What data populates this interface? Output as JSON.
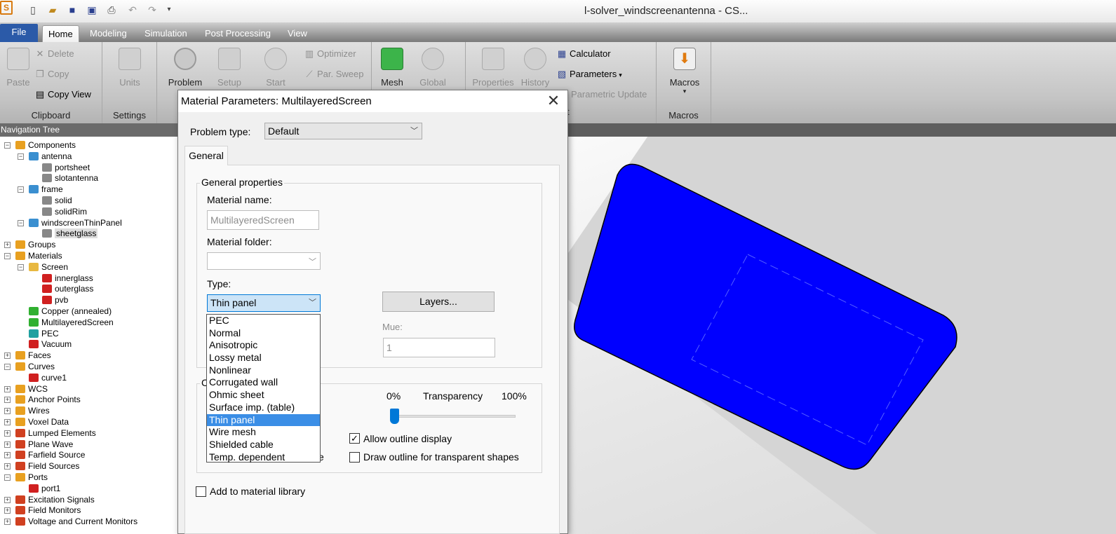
{
  "window": {
    "title": "l-solver_windscreenantenna - CS..."
  },
  "quick_access": [
    "new-file-icon",
    "open-folder-icon",
    "save-icon",
    "save-all-icon",
    "print-icon",
    "undo-icon",
    "redo-icon",
    "customize-dropdown-icon"
  ],
  "ribbon_tabs": [
    "File",
    "Home",
    "Modeling",
    "Simulation",
    "Post Processing",
    "View"
  ],
  "ribbon_active_tab": "Home",
  "ribbon": {
    "clipboard": {
      "paste": "Paste",
      "delete": "Delete",
      "copy": "Copy",
      "copy_view": "Copy View",
      "label": "Clipboard"
    },
    "settings": {
      "units": "Units",
      "label": "Settings"
    },
    "problem": "Problem",
    "problem_fragment": "T",
    "setup": "Setup",
    "start": "Start",
    "optimizer": "Optimizer",
    "par_sweep": "Par. Sweep",
    "mesh": "Mesh",
    "global": "Global",
    "properties": "Properties",
    "history": "History",
    "calculator": "Calculator",
    "parameters": "Parameters",
    "parametric_update": "Parametric Update",
    "macros": {
      "button": "Macros",
      "label": "Macros"
    },
    "mesh_group_fragment": "t"
  },
  "nav": {
    "header": "Navigation Tree",
    "items": [
      {
        "label": "Components"
      },
      {
        "label": "antenna"
      },
      {
        "label": "portsheet"
      },
      {
        "label": "slotantenna"
      },
      {
        "label": "frame"
      },
      {
        "label": "solid"
      },
      {
        "label": "solidRim"
      },
      {
        "label": "windscreenThinPanel"
      },
      {
        "label": "sheetglass"
      },
      {
        "label": "Groups"
      },
      {
        "label": "Materials"
      },
      {
        "label": "Screen"
      },
      {
        "label": "innerglass"
      },
      {
        "label": "outerglass"
      },
      {
        "label": "pvb"
      },
      {
        "label": "Copper (annealed)"
      },
      {
        "label": "MultilayeredScreen"
      },
      {
        "label": "PEC"
      },
      {
        "label": "Vacuum"
      },
      {
        "label": "Faces"
      },
      {
        "label": "Curves"
      },
      {
        "label": "curve1"
      },
      {
        "label": "WCS"
      },
      {
        "label": "Anchor Points"
      },
      {
        "label": "Wires"
      },
      {
        "label": "Voxel Data"
      },
      {
        "label": "Lumped Elements"
      },
      {
        "label": "Plane Wave"
      },
      {
        "label": "Farfield Source"
      },
      {
        "label": "Field Sources"
      },
      {
        "label": "Ports"
      },
      {
        "label": "port1"
      },
      {
        "label": "Excitation Signals"
      },
      {
        "label": "Field Monitors"
      },
      {
        "label": "Voltage and Current Monitors"
      }
    ]
  },
  "dialog": {
    "title": "Material Parameters: MultilayeredScreen",
    "problem_type_label": "Problem type:",
    "problem_type_value": "Default",
    "tab_general": "General",
    "general_properties": "General properties",
    "material_name_label": "Material name:",
    "material_name_value": "MultilayeredScreen",
    "material_folder_label": "Material folder:",
    "material_folder_value": "",
    "type_label": "Type:",
    "type_value": "Thin panel",
    "layers_button": "Layers...",
    "mue_label": "Mue:",
    "mue_value": "1",
    "transparency_min": "0%",
    "transparency_label": "Transparency",
    "transparency_max": "100%",
    "transparency_value": 0,
    "allow_outline": "Allow outline display",
    "allow_outline_checked": true,
    "draw_outline": "Draw outline for transparent shapes",
    "draw_outline_checked": false,
    "add_to_library": "Add to material library",
    "add_to_library_checked": false,
    "group2_fragment": "C",
    "hidden_text_fragment": "e",
    "type_options": [
      "PEC",
      "Normal",
      "Anisotropic",
      "Lossy metal",
      "Nonlinear",
      "Corrugated wall",
      "Ohmic sheet",
      "Surface imp. (table)",
      "Thin panel",
      "Wire mesh",
      "Shielded cable",
      "Temp. dependent"
    ],
    "type_selected_index": 8
  },
  "colors": {
    "panel_fill": "#0000ff",
    "file_tab": "#2b5aa8",
    "selection": "#3b8ee6"
  }
}
